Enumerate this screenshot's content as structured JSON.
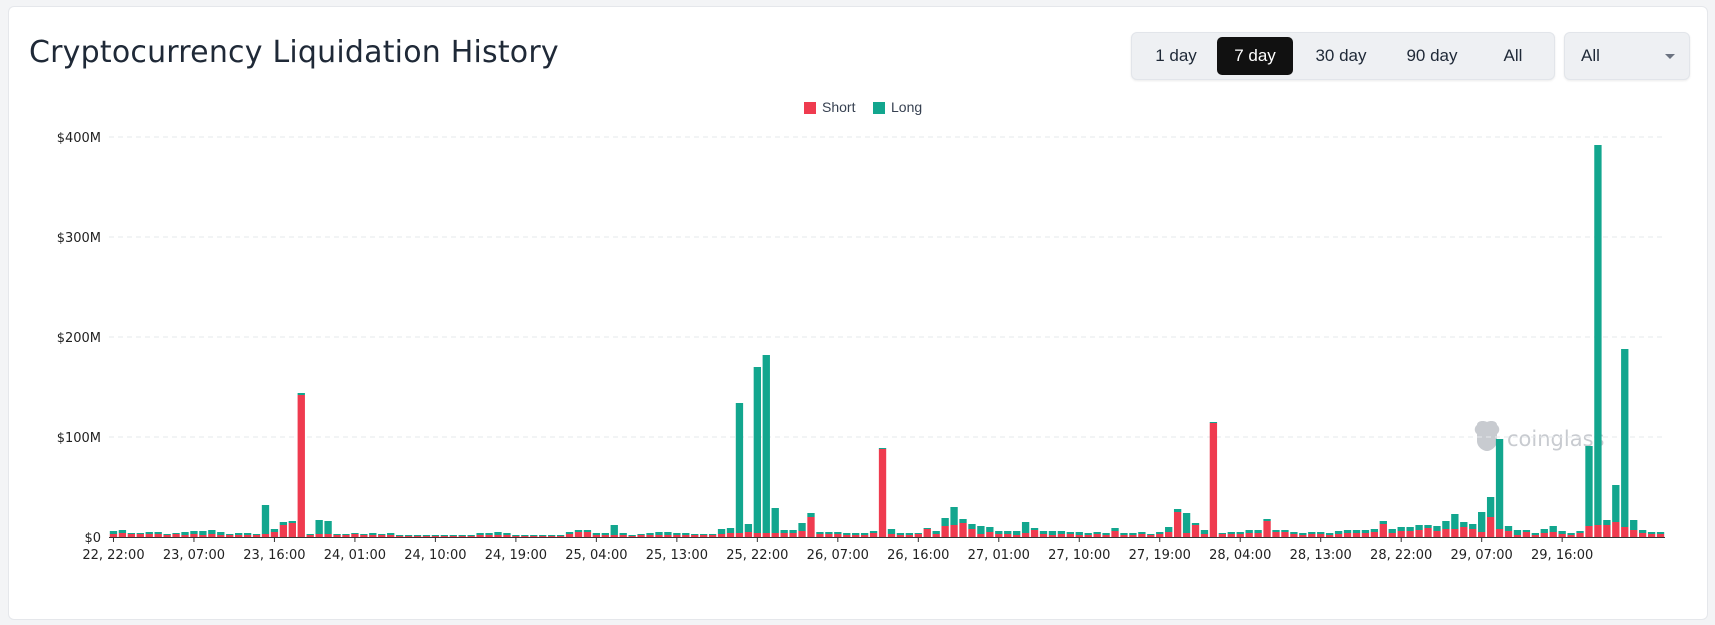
{
  "header": {
    "title": "Cryptocurrency Liquidation History",
    "ranges": [
      {
        "label": "1 day",
        "active": false
      },
      {
        "label": "7 day",
        "active": true
      },
      {
        "label": "30 day",
        "active": false
      },
      {
        "label": "90 day",
        "active": false
      },
      {
        "label": "All",
        "active": false
      }
    ],
    "select_value": "All"
  },
  "watermark": "coinglass",
  "chart_data": {
    "type": "bar",
    "stacked": true,
    "title": "",
    "xlabel": "",
    "ylabel": "",
    "ylim": [
      0,
      400
    ],
    "y_unit": "M",
    "y_ticks": [
      "$0",
      "$100M",
      "$200M",
      "$300M",
      "$400M"
    ],
    "grid": true,
    "legend_position": "top-center",
    "interval": "1 hour",
    "x_start": "22, 22:00",
    "x_tick_labels": [
      {
        "index": 0,
        "label": "22, 22:00"
      },
      {
        "index": 9,
        "label": "23, 07:00"
      },
      {
        "index": 18,
        "label": "23, 16:00"
      },
      {
        "index": 27,
        "label": "24, 01:00"
      },
      {
        "index": 36,
        "label": "24, 10:00"
      },
      {
        "index": 45,
        "label": "24, 19:00"
      },
      {
        "index": 54,
        "label": "25, 04:00"
      },
      {
        "index": 63,
        "label": "25, 13:00"
      },
      {
        "index": 72,
        "label": "25, 22:00"
      },
      {
        "index": 81,
        "label": "26, 07:00"
      },
      {
        "index": 90,
        "label": "26, 16:00"
      },
      {
        "index": 99,
        "label": "27, 01:00"
      },
      {
        "index": 108,
        "label": "27, 10:00"
      },
      {
        "index": 117,
        "label": "27, 19:00"
      },
      {
        "index": 126,
        "label": "28, 04:00"
      },
      {
        "index": 135,
        "label": "28, 13:00"
      },
      {
        "index": 144,
        "label": "28, 22:00"
      },
      {
        "index": 153,
        "label": "29, 07:00"
      },
      {
        "index": 162,
        "label": "29, 16:00"
      }
    ],
    "series": [
      {
        "name": "Short",
        "color": "#ef3b4f",
        "values": [
          3,
          4,
          3,
          3,
          3,
          3,
          2,
          3,
          2,
          3,
          2,
          3,
          2,
          2,
          2,
          2,
          2,
          3,
          5,
          12,
          14,
          142,
          2,
          3,
          3,
          2,
          2,
          3,
          2,
          2,
          2,
          2,
          1,
          1,
          1,
          1,
          1,
          1,
          1,
          1,
          1,
          2,
          2,
          2,
          2,
          1,
          1,
          1,
          1,
          1,
          1,
          3,
          5,
          5,
          2,
          2,
          2,
          2,
          1,
          2,
          2,
          2,
          2,
          2,
          2,
          2,
          2,
          2,
          3,
          4,
          4,
          5,
          4,
          4,
          4,
          4,
          4,
          6,
          20,
          3,
          3,
          3,
          2,
          2,
          2,
          4,
          88,
          3,
          2,
          2,
          3,
          8,
          3,
          11,
          12,
          14,
          8,
          3,
          5,
          3,
          3,
          2,
          4,
          7,
          3,
          2,
          3,
          3,
          2,
          2,
          3,
          2,
          6,
          2,
          2,
          3,
          2,
          3,
          5,
          25,
          4,
          12,
          3,
          114,
          3,
          3,
          3,
          4,
          4,
          16,
          5,
          5,
          3,
          2,
          3,
          3,
          2,
          3,
          4,
          4,
          4,
          5,
          13,
          4,
          6,
          6,
          7,
          9,
          6,
          8,
          8,
          10,
          8,
          5,
          20,
          8,
          6,
          2,
          5,
          2,
          4,
          5,
          3,
          2,
          4,
          11,
          12,
          12,
          15,
          10,
          7,
          4,
          3,
          3
        ]
      },
      {
        "name": "Long",
        "color": "#12a68e",
        "values": [
          3,
          3,
          1,
          1,
          2,
          2,
          1,
          1,
          3,
          3,
          4,
          4,
          3,
          1,
          2,
          2,
          1,
          29,
          3,
          3,
          2,
          2,
          1,
          14,
          13,
          1,
          1,
          1,
          1,
          2,
          1,
          2,
          1,
          1,
          1,
          1,
          1,
          1,
          1,
          1,
          1,
          2,
          2,
          3,
          2,
          1,
          1,
          1,
          1,
          1,
          1,
          2,
          2,
          2,
          2,
          2,
          10,
          2,
          1,
          1,
          2,
          3,
          3,
          2,
          2,
          1,
          1,
          1,
          5,
          5,
          130,
          8,
          166,
          178,
          25,
          3,
          3,
          8,
          4,
          2,
          2,
          2,
          2,
          2,
          2,
          2,
          1,
          5,
          2,
          2,
          1,
          1,
          3,
          8,
          18,
          4,
          5,
          8,
          5,
          3,
          3,
          4,
          11,
          2,
          3,
          4,
          3,
          2,
          3,
          2,
          2,
          2,
          3,
          2,
          2,
          2,
          1,
          2,
          5,
          3,
          20,
          2,
          4,
          1,
          1,
          2,
          2,
          3,
          3,
          2,
          2,
          2,
          2,
          2,
          2,
          2,
          2,
          3,
          3,
          3,
          3,
          3,
          3,
          4,
          4,
          4,
          5,
          3,
          5,
          8,
          15,
          5,
          5,
          20,
          20,
          90,
          5,
          5,
          2,
          2,
          4,
          6,
          3,
          2,
          2,
          80,
          380,
          5,
          37,
          178,
          10,
          3,
          2,
          2
        ]
      }
    ]
  }
}
